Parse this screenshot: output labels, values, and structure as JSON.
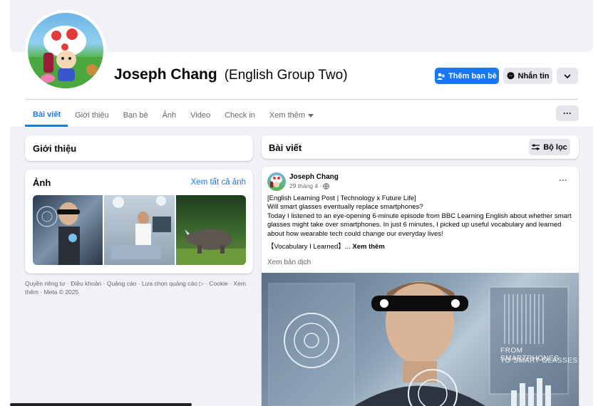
{
  "profile": {
    "name": "Joseph Chang",
    "alt_name": "(English Group Two)"
  },
  "actions": {
    "add_friend": "Thêm bạn bè",
    "message": "Nhắn tin"
  },
  "tabs": [
    {
      "label": "Bài viết",
      "active": true
    },
    {
      "label": "Giới thiệu"
    },
    {
      "label": "Bạn bè"
    },
    {
      "label": "Ảnh"
    },
    {
      "label": "Video"
    },
    {
      "label": "Check in"
    },
    {
      "label": "Xem thêm"
    }
  ],
  "more_button": "···",
  "intro": {
    "title": "Giới thiệu"
  },
  "photos": {
    "title": "Ảnh",
    "see_all": "Xem tất cả ảnh"
  },
  "footer": "Quyền riêng tư · Điều khoản · Quảng cáo · Lựa chọn quảng cáo ▷ · Cookie · Xem thêm · Meta © 2025",
  "posts_header": {
    "title": "Bài viết",
    "filter": "Bộ lọc"
  },
  "post": {
    "author": "Joseph Chang",
    "date": "29 tháng 4 ·",
    "menu": "···",
    "lines": [
      "[English Learning Post | Technology x Future Life]",
      "Will smart glasses eventually replace smartphones?",
      "Today I listened to an eye-opening 6-minute episode from BBC Learning English about whether smart glasses might take over smartphones. In just 6 minutes, I picked up useful vocabulary and learned about how wearable tech could change our everyday lives!"
    ],
    "vocab_line": "【Vocabulary I Learned】...",
    "see_more": "Xem thêm",
    "translate": "Xem bản dịch",
    "image_text_1": "FROM SMARTPHONES",
    "image_text_2": "TO SMART GLASSES"
  },
  "colors": {
    "accent": "#1877f2",
    "bg": "#f0f2f5"
  }
}
